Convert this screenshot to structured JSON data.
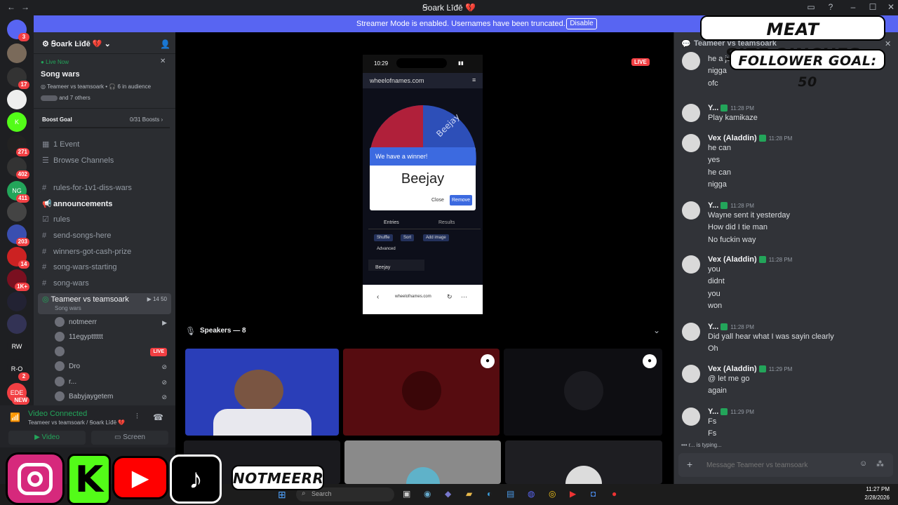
{
  "window": {
    "title": "Ꞩoark Ŀīđē 💔"
  },
  "banner": {
    "message": "Streamer Mode is enabled. Usernames have been truncated.",
    "disable_label": "Disable"
  },
  "servers": [
    {
      "label": "",
      "badge": "3"
    },
    {
      "label": "",
      "badge": ""
    },
    {
      "label": "",
      "badge": "17"
    },
    {
      "label": "",
      "badge": ""
    },
    {
      "label": "K",
      "badge": ""
    },
    {
      "label": "",
      "badge": "271"
    },
    {
      "label": "",
      "badge": "402"
    },
    {
      "label": "NG",
      "badge": "411"
    },
    {
      "label": "",
      "badge": ""
    },
    {
      "label": "",
      "badge": "203"
    },
    {
      "label": "",
      "badge": "14"
    },
    {
      "label": "",
      "badge": "1K+"
    },
    {
      "label": "",
      "badge": ""
    },
    {
      "label": "",
      "badge": ""
    },
    {
      "label": "RW",
      "badge": ""
    },
    {
      "label": "R-O",
      "badge": "2"
    },
    {
      "label": "EDE",
      "badge": "NEW"
    }
  ],
  "sidebar": {
    "server_name": "Ꞩoark Ŀīđē 💔",
    "live_label": "Live Now",
    "live_title": "Song wars",
    "live_channel": "Teameer vs teamsoark",
    "audience": "6 in audience",
    "others": "and 7 others",
    "boost_label": "Boost Goal",
    "boost_value": "0/31 Boosts",
    "events": "1 Event",
    "browse": "Browse Channels",
    "channels": [
      {
        "name": "rules-for-1v1-diss-wars",
        "icon": "#",
        "bold": false
      },
      {
        "name": "announcements",
        "icon": "📢",
        "bold": true
      },
      {
        "name": "rules",
        "icon": "☑",
        "bold": false
      },
      {
        "name": "send-songs-here",
        "icon": "#",
        "bold": false
      },
      {
        "name": "winners-got-cash-prize",
        "icon": "#",
        "bold": false
      },
      {
        "name": "song-wars-starting",
        "icon": "#",
        "bold": false
      },
      {
        "name": "song-wars",
        "icon": "#",
        "bold": false
      }
    ],
    "stage": {
      "name": "Teameer vs teamsoark",
      "sub": "Song wars",
      "video_count": "14",
      "count": "50"
    },
    "users": [
      "notmeerr",
      "11egyptttttt",
      "",
      "Dro",
      "r...",
      "Babyjaygetem"
    ],
    "live_tag": "LIVE"
  },
  "voice": {
    "status": "Video Connected",
    "channel": "Teameer vs teamsoark / Ꞩoark Ŀīđē 💔",
    "video_label": "Video",
    "screen_label": "Screen"
  },
  "stream": {
    "live_tag": "LIVE",
    "phone_time": "10:29",
    "url": "wheelofnames.com",
    "wheel_name": "Beejay",
    "dialog_title": "We have a winner!",
    "winner": "Beejay",
    "close_label": "Close",
    "remove_label": "Remove",
    "tab_entries": "Entries",
    "tab_results": "Results",
    "shuffle": "Shuffle",
    "sort": "Sort",
    "add_image": "Add image",
    "advanced": "Advanced",
    "entry": "Beejay",
    "bottom_url": "wheelofnames.com"
  },
  "speakers": {
    "label": "Speakers — 8"
  },
  "chat": {
    "channel": "Teameer vs teamsoark",
    "messages": [
      {
        "author": "",
        "time": "",
        "lines": [
          "he a juc",
          "nigga",
          "ofc"
        ]
      },
      {
        "author": "Y...",
        "time": "11:28 PM",
        "lines": [
          "Play kamikaze"
        ]
      },
      {
        "author": "Vex (Aladdin)",
        "time": "11:28 PM",
        "lines": [
          "he can",
          "yes",
          "he can",
          "nigga"
        ]
      },
      {
        "author": "Y...",
        "time": "11:28 PM",
        "lines": [
          "Wayne sent it yesterday",
          "How did I tie man",
          "No fuckin way"
        ]
      },
      {
        "author": "Vex (Aladdin)",
        "time": "11:28 PM",
        "lines": [
          "you",
          "didnt",
          "you",
          "won"
        ]
      },
      {
        "author": "Y...",
        "time": "11:28 PM",
        "lines": [
          "Did yall hear what I was sayin clearly",
          "Oh"
        ]
      },
      {
        "author": "Vex (Aladdin)",
        "time": "11:29 PM",
        "lines": [
          "@ let  me go",
          "again"
        ]
      },
      {
        "author": "Y...",
        "time": "11:29 PM",
        "lines": [
          "Fs",
          "Fs"
        ]
      }
    ],
    "typing": "r... is typing...",
    "input_placeholder": "Message Teameer vs teamsoark"
  },
  "overlay": {
    "line1": "MEAT SIZE:2INCHES",
    "line2": "FOLLOWER GOAL: 50",
    "handle": "NOTMEERR"
  },
  "taskbar": {
    "search_placeholder": "Search",
    "time": "11:27 PM",
    "date": "2/28/2026"
  }
}
